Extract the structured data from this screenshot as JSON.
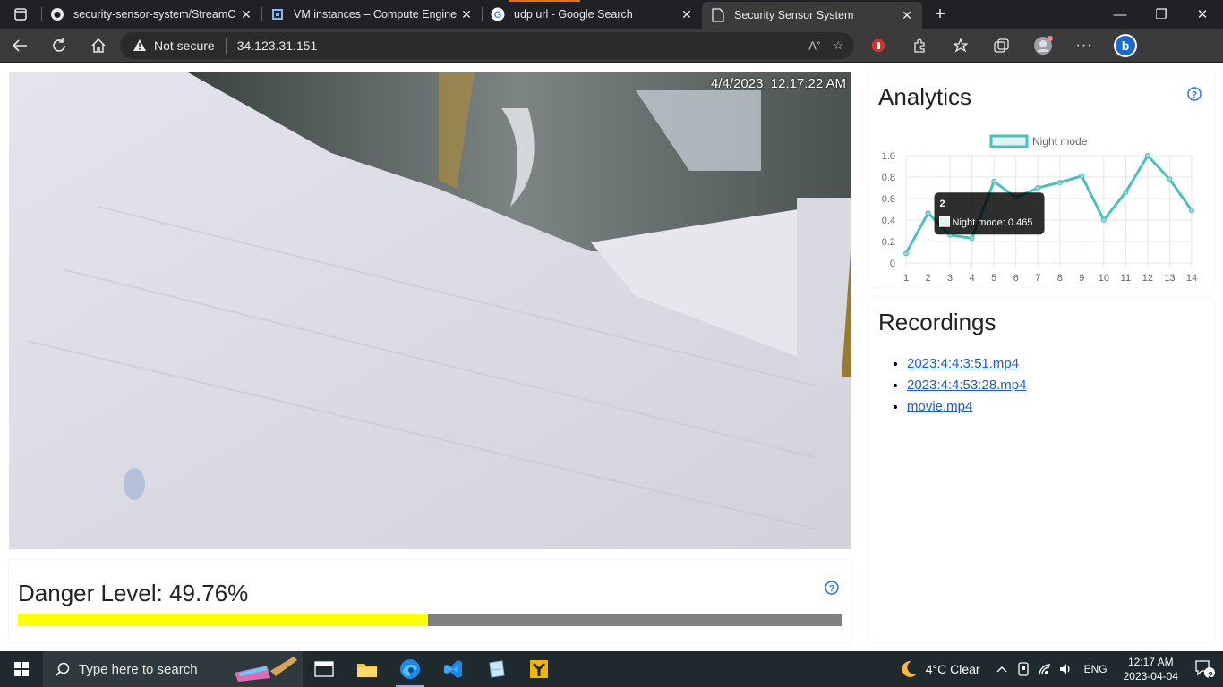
{
  "browser": {
    "tabs": [
      {
        "title": "security-sensor-system/StreamC",
        "icon": "github-icon",
        "active": false
      },
      {
        "title": "VM instances – Compute Engine",
        "icon": "compute-engine-icon",
        "active": false
      },
      {
        "title": "udp url - Google Search",
        "icon": "google-icon",
        "active": false
      },
      {
        "title": "Security Sensor System",
        "icon": "page-icon",
        "active": true
      }
    ],
    "security_label": "Not secure",
    "url": "34.123.31.151"
  },
  "camera": {
    "timestamp": "4/4/2023, 12:17:22 AM"
  },
  "danger": {
    "label": "Danger Level: 49.76%",
    "level": 0.4976,
    "bar_color": "#ffff00",
    "track_color": "#808080"
  },
  "analytics": {
    "title": "Analytics",
    "tooltip": {
      "title": "2",
      "text": "Night mode: 0.465"
    }
  },
  "chart_data": {
    "type": "line",
    "title": "",
    "x": [
      1,
      2,
      3,
      4,
      5,
      6,
      7,
      8,
      9,
      10,
      11,
      12,
      13,
      14
    ],
    "series": [
      {
        "name": "Night mode",
        "color": "#4bc0c0",
        "values": [
          0.09,
          0.465,
          0.26,
          0.23,
          0.76,
          0.61,
          0.7,
          0.75,
          0.81,
          0.4,
          0.66,
          1.0,
          0.78,
          0.49
        ]
      }
    ],
    "ylim": [
      0,
      1.0
    ],
    "yticks": [
      "0",
      "0.2",
      "0.4",
      "0.6",
      "0.8",
      "1.0"
    ],
    "grid": true,
    "legend": "top-center"
  },
  "recordings": {
    "title": "Recordings",
    "items": [
      "2023:4:4:3:51.mp4",
      "2023:4:4:53:28.mp4",
      "movie.mp4"
    ]
  },
  "taskbar": {
    "search_placeholder": "Type here to search",
    "weather": "4°C  Clear",
    "language": "ENG",
    "time": "12:17 AM",
    "date": "2023-04-04",
    "notification_count": "2"
  }
}
